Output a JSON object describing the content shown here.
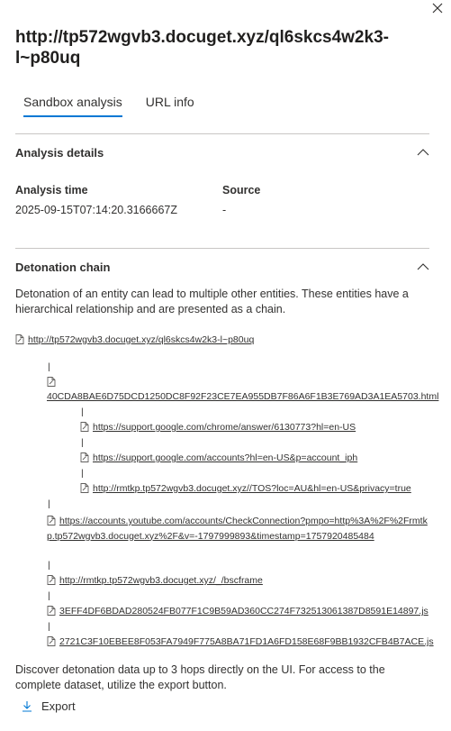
{
  "panel": {
    "title": "http://tp572wgvb3.docuget.xyz/ql6skcs4w2k3-l~p80uq"
  },
  "tabs": [
    {
      "label": "Sandbox analysis",
      "selected": true
    },
    {
      "label": "URL info",
      "selected": false
    }
  ],
  "analysis_details": {
    "title": "Analysis details",
    "time_label": "Analysis time",
    "time_value": "2025-09-15T07:14:20.3166667Z",
    "source_label": "Source",
    "source_value": "-"
  },
  "detonation_chain": {
    "title": "Detonation chain",
    "description": "Detonation of an entity can lead to multiple other entities. These entities have a hierarchical relationship and are presented as a chain.",
    "root": "http://tp572wgvb3.docuget.xyz/ql6skcs4w2k3-l~p80uq",
    "nodes": [
      "40CDA8BAE6D75DCD1250DC8F92F23CE7EA955DB7F86A6F1B3E769AD3A1EA5703.html",
      "https://support.google.com/chrome/answer/6130773?hl=en-US",
      "https://support.google.com/accounts?hl=en-US&p=account_iph",
      "http://rmtkp.tp572wgvb3.docuget.xyz//TOS?loc=AU&hl=en-US&privacy=true",
      "https://accounts.youtube.com/accounts/CheckConnection?pmpo=http%3A%2F%2Frmtkp.tp572wgvb3.docuget.xyz%2F&v=-1797999893&timestamp=1757920485484",
      "http://rmtkp.tp572wgvb3.docuget.xyz/_/bscframe",
      "3EFF4DF6BDAD280524FB077F1C9B59AD360CC274F732513061387D8591E14897.js",
      "2721C3F10EBEE8F053FA7949F775A8BA71FD1A6FD158E68F9BB1932CFB4B7ACE.js"
    ],
    "pipe": "|",
    "footer": "Discover detonation data up to 3 hops directly on the UI. For access to the complete dataset, utilize the export button."
  },
  "actions": {
    "export_label": "Export"
  },
  "colors": {
    "accent": "#0078d4",
    "divider": "#c8c6c4",
    "text": "#323130"
  }
}
